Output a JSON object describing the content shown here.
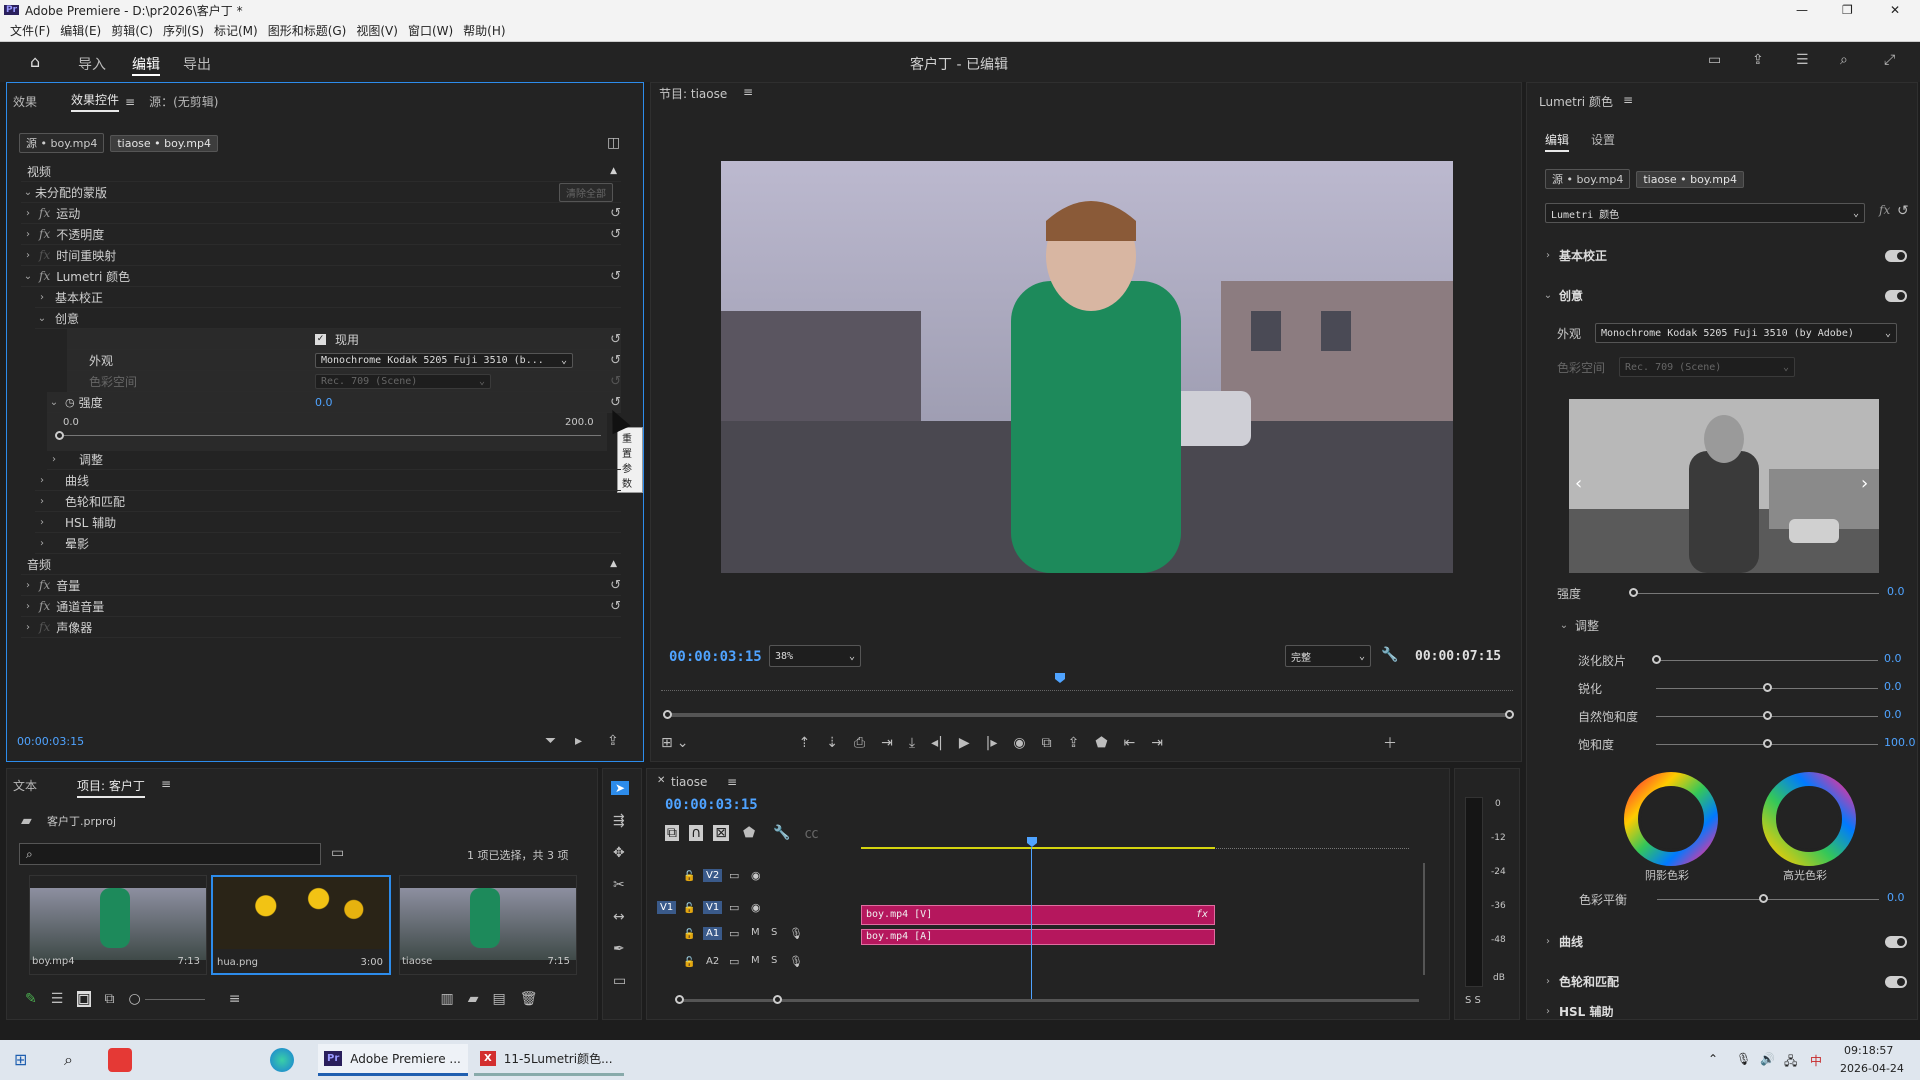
{
  "app": {
    "title": "Adobe Premiere - D:\\pr2026\\客户丁 *",
    "logo": "Pr"
  },
  "menu": [
    "文件(F)",
    "编辑(E)",
    "剪辑(C)",
    "序列(S)",
    "标记(M)",
    "图形和标题(G)",
    "视图(V)",
    "窗口(W)",
    "帮助(H)"
  ],
  "workspace": {
    "tabs": [
      "导入",
      "编辑",
      "导出"
    ],
    "active": "编辑",
    "project_title": "客户丁 - 已编辑"
  },
  "effect_controls": {
    "tabs": [
      "效果",
      "效果控件",
      "源：(无剪辑)"
    ],
    "source_chip": "源 • boy.mp4",
    "seq_chip": "tiaose • boy.mp4",
    "video_header": "视频",
    "unassigned_mask": "未分配的蒙版",
    "clear_all": "清除全部",
    "rows": [
      "运动",
      "不透明度",
      "时间重映射",
      "Lumetri 颜色"
    ],
    "lumetri_children": [
      "基本校正",
      "创意"
    ],
    "enable_label": "现用",
    "look_label": "外观",
    "look_value": "Monochrome Kodak 5205 Fuji 3510 (b...",
    "colorspace_label": "色彩空间",
    "colorspace_value": "Rec. 709 (Scene)",
    "intensity_label": "强度",
    "intensity_value": "0.0",
    "range_min": "0.0",
    "range_max": "200.0",
    "tooltip": "重置参数",
    "more_rows": [
      "调整",
      "曲线",
      "色轮和匹配",
      "HSL 辅助",
      "晕影"
    ],
    "audio_header": "音频",
    "audio_rows": [
      "音量",
      "通道音量",
      "声像器"
    ],
    "timecode": "00:00:03:15"
  },
  "program_monitor": {
    "title": "节目: tiaose",
    "timecode": "00:00:03:15",
    "zoom": "38%",
    "quality": "完整",
    "duration": "00:00:07:15"
  },
  "lumetri_panel": {
    "title": "Lumetri 颜色",
    "tabs": [
      "编辑",
      "设置"
    ],
    "source_chip": "源 • boy.mp4",
    "seq_chip": "tiaose • boy.mp4",
    "effect_select": "Lumetri 颜色",
    "basic": "基本校正",
    "creative": "创意",
    "look_label": "外观",
    "look_value": "Monochrome Kodak 5205 Fuji 3510 (by Adobe)",
    "colorspace_label": "色彩空间",
    "colorspace_value": "Rec. 709 (Scene)",
    "intensity_label": "强度",
    "intensity_value": "0.0",
    "adjust": "调整",
    "sliders": [
      {
        "label": "淡化胶片",
        "value": "0.0"
      },
      {
        "label": "锐化",
        "value": "0.0"
      },
      {
        "label": "自然饱和度",
        "value": "0.0"
      },
      {
        "label": "饱和度",
        "value": "100.0"
      }
    ],
    "wheel_shadow": "阴影色彩",
    "wheel_highlight": "高光色彩",
    "balance_label": "色彩平衡",
    "balance_value": "0.0",
    "curves": "曲线",
    "wheels_match": "色轮和匹配",
    "hsl_partial": "HSL 辅助"
  },
  "project": {
    "tabs": [
      "文本",
      "项目: 客户丁"
    ],
    "file": "客户丁.prproj",
    "search_placeholder": "",
    "selection": "1 项已选择，共 3 项",
    "items": [
      {
        "name": "boy.mp4",
        "duration": "7:13"
      },
      {
        "name": "hua.png",
        "duration": "3:00"
      },
      {
        "name": "tiaose",
        "duration": "7:15"
      }
    ]
  },
  "timeline": {
    "title": "tiaose",
    "timecode": "00:00:03:15",
    "tracks": [
      {
        "target": "",
        "name": "V2"
      },
      {
        "target": "V1",
        "name": "V1"
      },
      {
        "target": "",
        "name": "A1"
      },
      {
        "target": "",
        "name": "A2"
      }
    ],
    "clip_video": "boy.mp4 [V]",
    "clip_audio": "boy.mp4 [A]",
    "fx_badge": "fx"
  },
  "meter": {
    "scale": [
      "0",
      "-12",
      "-24",
      "-36",
      "-48",
      "dB"
    ],
    "solo": "S S"
  },
  "taskbar": {
    "apps": [
      {
        "label": "Adobe Premiere ...",
        "icon": "Pr"
      },
      {
        "label": "11-5Lumetri颜色...",
        "icon": "X"
      }
    ],
    "time": "09:18:57",
    "date": "2026-04-24",
    "ime": "中"
  },
  "colors": {
    "accent": "#2d8ceb",
    "timecode": "#4fa3ff",
    "clip": "#b5175d",
    "pr_brand": "#2a1f5c"
  }
}
